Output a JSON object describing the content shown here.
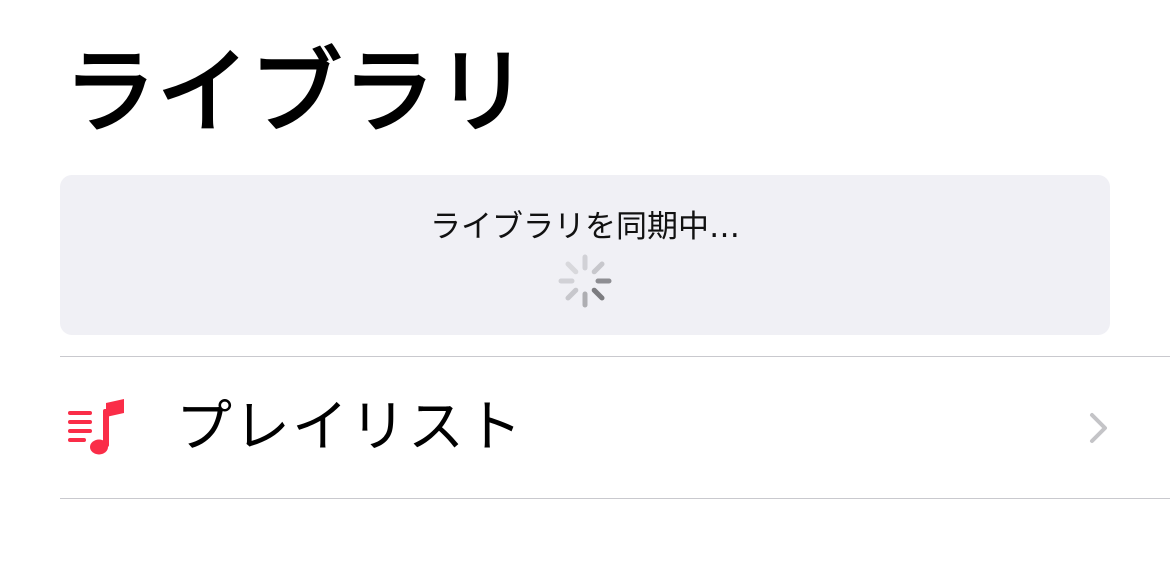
{
  "header": {
    "title": "ライブラリ"
  },
  "sync_card": {
    "message": "ライブラリを同期中…",
    "spinner_icon": "activity-spinner-icon"
  },
  "list": {
    "items": [
      {
        "label": "プレイリスト",
        "icon": "playlist-icon",
        "chevron_icon": "chevron-right-icon"
      }
    ]
  },
  "colors": {
    "accent": "#fa2d48",
    "card_background": "#f0f0f5",
    "divider": "#c9c9ce",
    "chevron": "#c4c4c7",
    "spinner": "#8e8e93"
  }
}
